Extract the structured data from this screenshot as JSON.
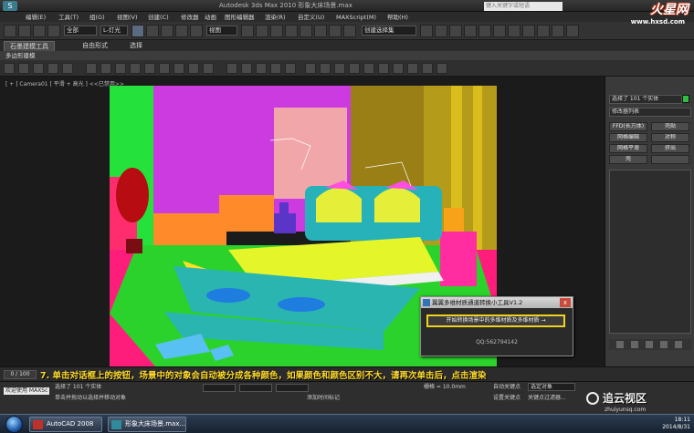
{
  "titlebar": {
    "title": "Autodesk 3ds Max 2010   形象大床场景.max",
    "search_placeholder": "键入关键字或短语",
    "site_logo": "火星网",
    "site_url": "www.hxsd.com"
  },
  "menu": [
    "编辑(E)",
    "工具(T)",
    "组(G)",
    "视图(V)",
    "创建(C)",
    "修改器",
    "动画",
    "图形编辑器",
    "渲染(R)",
    "自定义(U)",
    "MAXScript(M)",
    "帮助(H)"
  ],
  "toolbar": {
    "selection_filter": "全部",
    "light_dropdown": "L-灯光",
    "view_dropdown": "视图",
    "named_selection": "创建选择集"
  },
  "ribbon": {
    "tabs": [
      "石墨建模工具",
      "自由形式",
      "选择"
    ],
    "sub_label": "多边形建模"
  },
  "viewport": {
    "label": "[ + ] Camera01 [ 平滑 + 高光 ] <<已禁用>>"
  },
  "caption": "7. 单击对话框上的按钮，场景中的对象会自动被分成各种颜色，如果颜色和颜色区别不大，请再次单击后，点击渲染",
  "dialog": {
    "title": "翼翼多维材质通道转换小工具V1.2",
    "close": "x",
    "button": "开始转换场景中的多维材质及多维材质 →",
    "qq": "QQ:562794142"
  },
  "command_panel": {
    "selection": "选择了 101 个实体",
    "modifier_list": "修改器列表",
    "buttons": [
      [
        "FFD(长方体)",
        "壳贴"
      ],
      [
        "网格编辑",
        "对称"
      ],
      [
        "网格平滑",
        "挤出"
      ],
      [
        "壳",
        ""
      ]
    ]
  },
  "timeline": {
    "frame": "0 / 100"
  },
  "status": {
    "maxscript_label": "欢迎使用 MAXSc",
    "selected": "选择了 101 个实体",
    "prompt": "单击并拖动以选择并移动对象",
    "grid": "栅格 = 10.0mm",
    "autokey": "自动关键点",
    "set_key": "设置关键点",
    "key_filter": "关键点过滤器...",
    "selected_obj": "选定对象",
    "add_time_tag": "添加时间标记"
  },
  "taskbar": {
    "tasks": [
      "AutoCAD 2008",
      "形象大床场景.max..."
    ],
    "clock_time": "18:11",
    "clock_date": "2014/8/31"
  },
  "site_badge": {
    "name": "追云视区",
    "url": "zhuiyunsq.com"
  }
}
